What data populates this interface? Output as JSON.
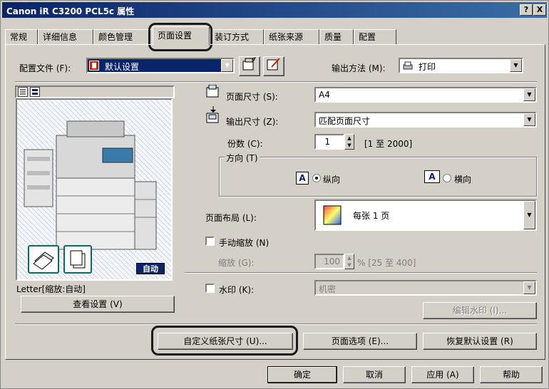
{
  "window": {
    "title": "Canon iR C3200 PCL5c 属性",
    "help_btn": "?",
    "close_btn": "X"
  },
  "tabs": [
    {
      "label": "常规"
    },
    {
      "label": "详细信息"
    },
    {
      "label": "颜色管理"
    },
    {
      "label": "页面设置",
      "active": true
    },
    {
      "label": "装订方式"
    },
    {
      "label": "纸张来源"
    },
    {
      "label": "质量"
    },
    {
      "label": "配置"
    }
  ],
  "profile": {
    "label": "配置文件 (F):",
    "value": "默认设置"
  },
  "output_method": {
    "label": "输出方法 (M):",
    "value": "打印"
  },
  "page_size": {
    "label": "页面尺寸 (S):",
    "value": "A4"
  },
  "output_size": {
    "label": "输出尺寸 (Z):",
    "value": "匹配页面尺寸"
  },
  "copies": {
    "label": "份数 (C):",
    "value": "1",
    "range": "[1 至 2000]"
  },
  "orientation": {
    "label": "方向 (T)",
    "portrait": "纵向",
    "landscape": "横向",
    "selected": "portrait"
  },
  "page_layout": {
    "label": "页面布局 (L):",
    "value": "每张 1 页"
  },
  "manual_scaling": {
    "label": "手动缩放 (N)",
    "checked": false
  },
  "scaling": {
    "label": "缩放 (G):",
    "value": "100",
    "range": "% [25 至 400]"
  },
  "watermark": {
    "label": "水印 (K):",
    "checked": false,
    "value": "机密",
    "edit_button": "编辑水印 (I)..."
  },
  "preview": {
    "status": "Letter[缩放:自动]",
    "auto_badge": "自动",
    "view_settings_button": "查看设置 (V)"
  },
  "buttons": {
    "custom_paper": "自定义纸张尺寸 (U)...",
    "page_options": "页面选项 (E)...",
    "restore_defaults": "恢复默认设置 (R)",
    "ok": "确定",
    "cancel": "取消",
    "apply": "应用 (A)",
    "help": "帮助"
  }
}
